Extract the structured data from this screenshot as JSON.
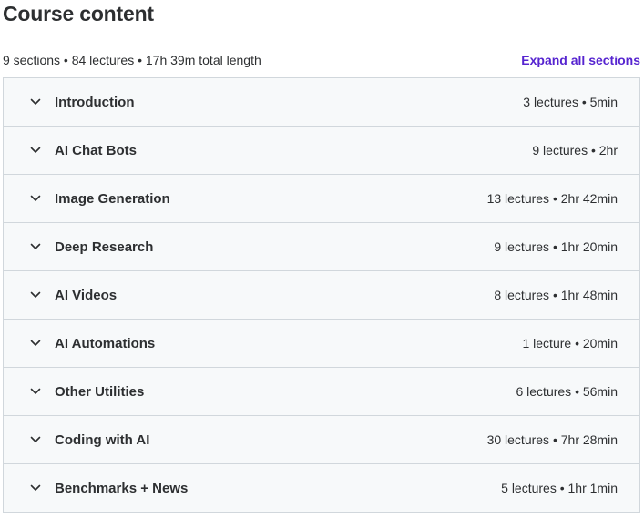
{
  "header": {
    "title": "Course content",
    "summary": "9 sections • 84 lectures • 17h 39m total length",
    "expand_label": "Expand all sections"
  },
  "icons": {
    "section_toggle": "chevron-down-icon"
  },
  "colors": {
    "accent": "#5624d0",
    "section_bg": "#f7f9fa",
    "border": "#d1d7dc",
    "text": "#2d2f31"
  },
  "sections": [
    {
      "title": "Introduction",
      "meta": "3 lectures • 5min"
    },
    {
      "title": "AI Chat Bots",
      "meta": "9 lectures • 2hr"
    },
    {
      "title": "Image Generation",
      "meta": "13 lectures • 2hr 42min"
    },
    {
      "title": "Deep Research",
      "meta": "9 lectures • 1hr 20min"
    },
    {
      "title": "AI Videos",
      "meta": "8 lectures • 1hr 48min"
    },
    {
      "title": "AI Automations",
      "meta": "1 lecture • 20min"
    },
    {
      "title": "Other Utilities",
      "meta": "6 lectures • 56min"
    },
    {
      "title": "Coding with AI",
      "meta": "30 lectures • 7hr 28min"
    },
    {
      "title": "Benchmarks + News",
      "meta": "5 lectures • 1hr 1min"
    }
  ]
}
